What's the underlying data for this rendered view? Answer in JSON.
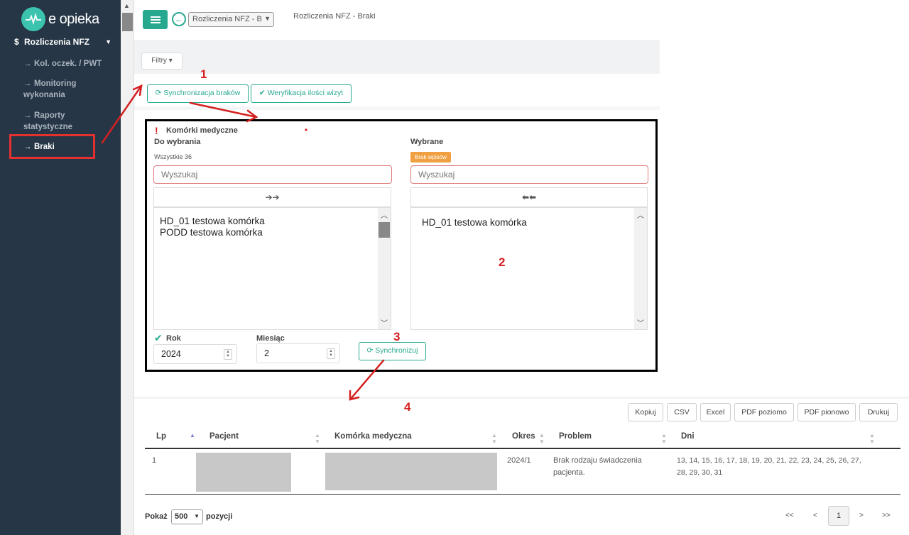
{
  "sidebar": {
    "logo_text": "e opieka",
    "section_label": "Rozliczenia NFZ",
    "items": [
      {
        "label": "Kol. oczek. / PWT"
      },
      {
        "label": "Monitoring wykonania"
      },
      {
        "label": "Raporty statystyczne"
      },
      {
        "label": "Braki"
      }
    ]
  },
  "header": {
    "crumb_select": "Rozliczenia NFZ - B",
    "page_title": "Rozliczenia NFZ - Braki"
  },
  "toolbar": {
    "filters_label": "Filtry",
    "sync_label": "Synchronizacja braków",
    "verify_label": "Weryfikacja ilości wizyt"
  },
  "form": {
    "section_label": "Komórki medyczne",
    "available": {
      "title": "Do wybrania",
      "count_label": "Wszystkie 36",
      "search_placeholder": "Wyszukaj",
      "items": [
        "HD_01 testowa komórka",
        "PODD testowa komórka"
      ]
    },
    "selected": {
      "title": "Wybrane",
      "badge": "Brak wpisów",
      "search_placeholder": "Wyszukaj",
      "items": [
        "HD_01 testowa komórka"
      ]
    },
    "year_label": "Rok",
    "year_value": "2024",
    "month_label": "Miesiąc",
    "month_value": "2",
    "sync_button": "Synchronizuj"
  },
  "export_buttons": [
    "Kopiuj",
    "CSV",
    "Excel",
    "PDF poziomo",
    "PDF pionowo",
    "Drukuj"
  ],
  "table": {
    "headers": [
      "Lp",
      "Pacjent",
      "Komórka medyczna",
      "Okres",
      "Problem",
      "Dni"
    ],
    "rows": [
      {
        "lp": "1",
        "okres": "2024/1",
        "problem": "Brak rodzaju świadczenia pacjenta.",
        "dni": "13, 14, 15, 16, 17, 18, 19, 20, 21, 22, 23, 24, 25, 26, 27, 28, 29, 30, 31"
      }
    ]
  },
  "footer": {
    "show_label": "Pokaż",
    "page_size": "500",
    "entries_label": "pozycji",
    "pagination": {
      "first": "<<",
      "prev": "<",
      "current": "1",
      "next": ">",
      "last": ">>"
    }
  },
  "annotations": [
    "1",
    "2",
    "3",
    "4"
  ],
  "colors": {
    "sidebar_bg": "#263646",
    "accent": "#27a88f",
    "annotation": "#d42020"
  }
}
